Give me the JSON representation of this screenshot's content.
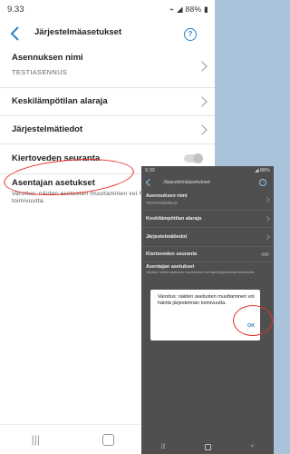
{
  "main_screen": {
    "status_bar": {
      "time": "9.33",
      "battery": "88%"
    },
    "title": "Järjestelmäasetukset",
    "items": [
      {
        "label": "Asennuksen nimi",
        "value": "TESTIASENNUS"
      },
      {
        "label": "Keskilämpötilan alaraja"
      },
      {
        "label": "Järjestelmätiedot"
      },
      {
        "label": "Kiertoveden seuranta",
        "toggle_on": false
      },
      {
        "label": "Asentajan asetukset",
        "note": "Varoitus: näiden asetusten muuttaminen voi häiritä järjestelmän toimivuutta."
      }
    ],
    "nav": {
      "recent": "|||",
      "back": "<"
    }
  },
  "overlay_screen": {
    "status_bar": {
      "time": "9.33",
      "battery": "88%"
    },
    "title": "Järjestelmäasetukset",
    "items": [
      {
        "label": "Asennuksen nimi",
        "value": "TESTIASENNUS"
      },
      {
        "label": "Keskilämpötilan alaraja"
      },
      {
        "label": "Järjestelmätiedot"
      },
      {
        "label": "Kiertoveden seuranta"
      },
      {
        "label": "Asentajan asetukset",
        "note": "Varoitus: näiden asetusten muuttaminen voi häiritä järjestelmän toimivuutta."
      }
    ],
    "dialog": {
      "message": "Varoitus: näiden asetusten muuttaminen voi häiritä järjestelmän toimivuutta.",
      "ok_label": "OK"
    },
    "nav": {
      "recent": "|||",
      "back": "<"
    }
  },
  "annotation_color": "#e5312b"
}
